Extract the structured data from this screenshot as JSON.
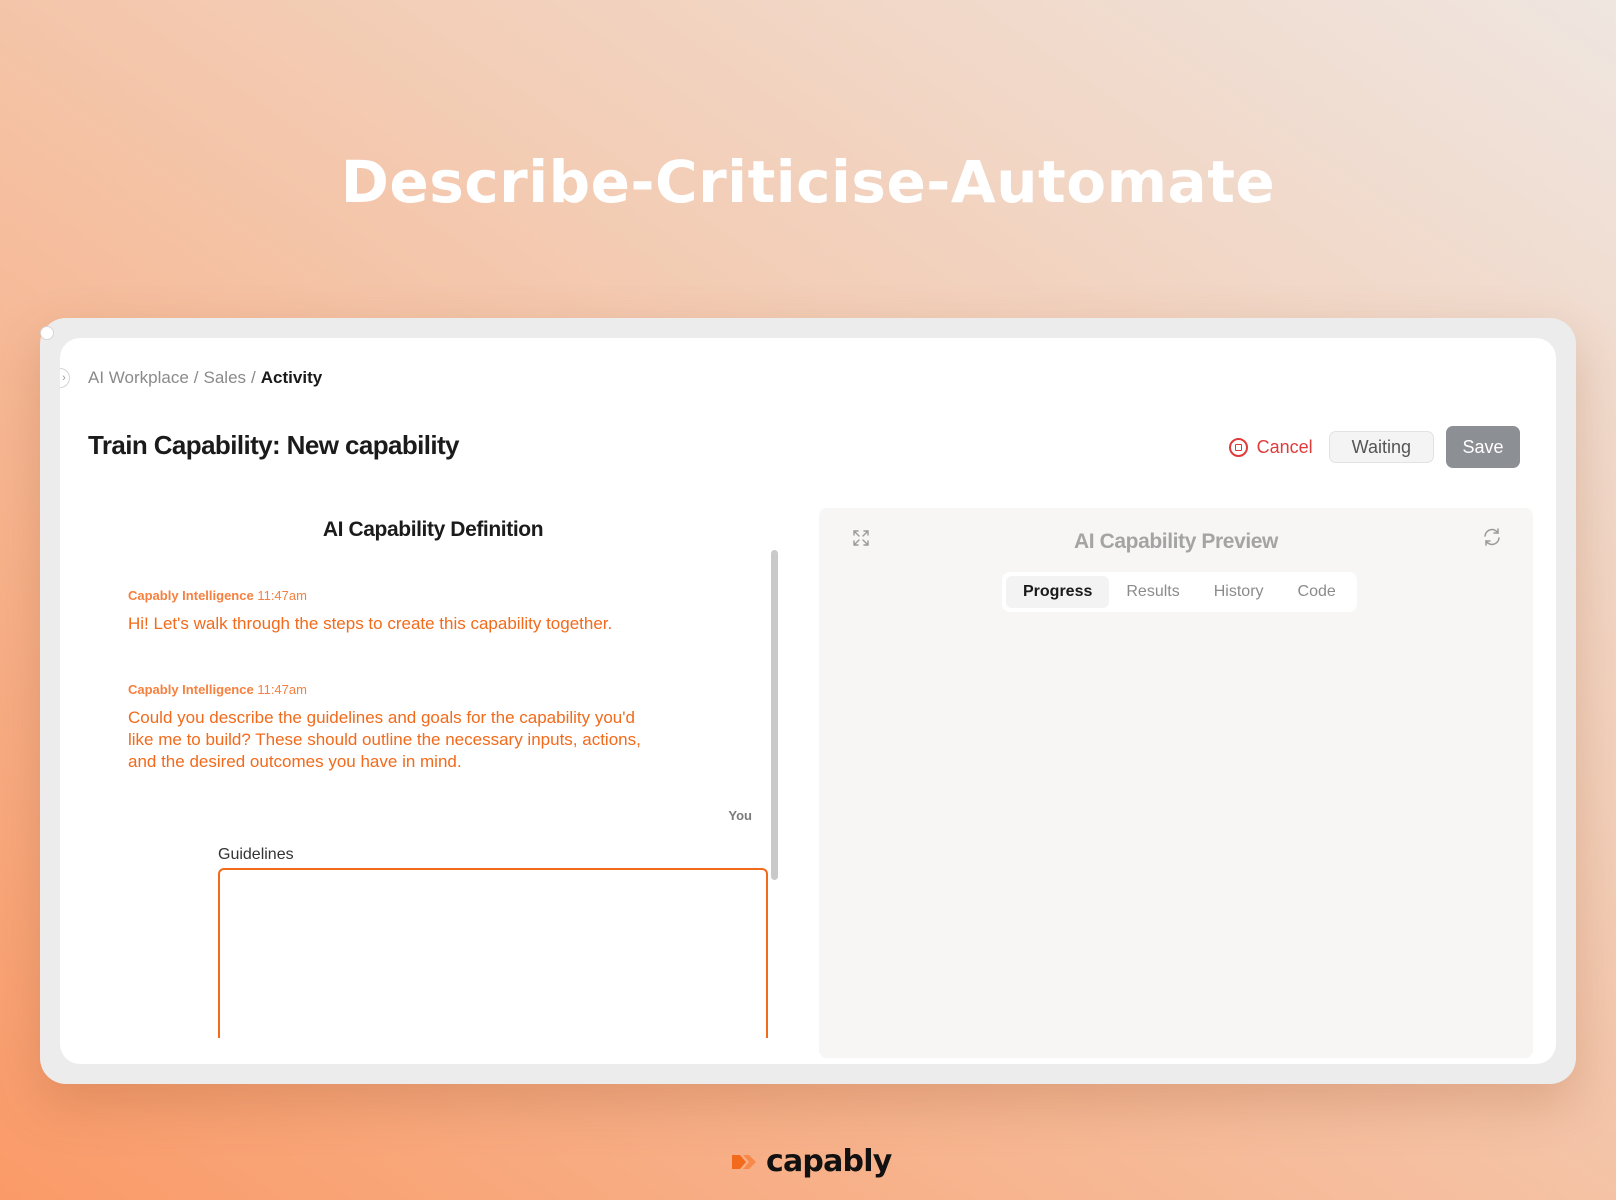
{
  "hero": {
    "title": "Describe-Criticise-Automate"
  },
  "breadcrumb": {
    "items": [
      "AI Workplace",
      "/",
      "Sales",
      "/",
      "Activity"
    ]
  },
  "page": {
    "title": "Train Capability: New capability"
  },
  "actions": {
    "cancel_label": "Cancel",
    "waiting_label": "Waiting",
    "save_label": "Save"
  },
  "definition": {
    "title": "AI Capability Definition",
    "messages": [
      {
        "sender": "Capably Intelligence",
        "time": "11:47am",
        "text": "Hi! Let's walk through the steps to create this capability together."
      },
      {
        "sender": "Capably Intelligence",
        "time": "11:47am",
        "text": "Could you describe the guidelines and goals for the capability you'd like me to build? These should outline the necessary inputs, actions, and the desired outcomes you have in mind."
      }
    ],
    "you_label": "You",
    "guidelines_label": "Guidelines",
    "guidelines_value": ""
  },
  "preview": {
    "title": "AI Capability Preview",
    "tabs": [
      "Progress",
      "Results",
      "History",
      "Code"
    ],
    "active_tab": "Progress"
  },
  "brand": {
    "name": "capably"
  },
  "colors": {
    "accent": "#f26a1b",
    "danger": "#e03b3b",
    "save_button": "#8c8f94"
  },
  "icons": {
    "cancel": "stop-circle-icon",
    "expand": "expand-icon",
    "refresh": "refresh-icon",
    "collapse": "chevron-right-icon",
    "brand": "capably-logo-icon"
  }
}
